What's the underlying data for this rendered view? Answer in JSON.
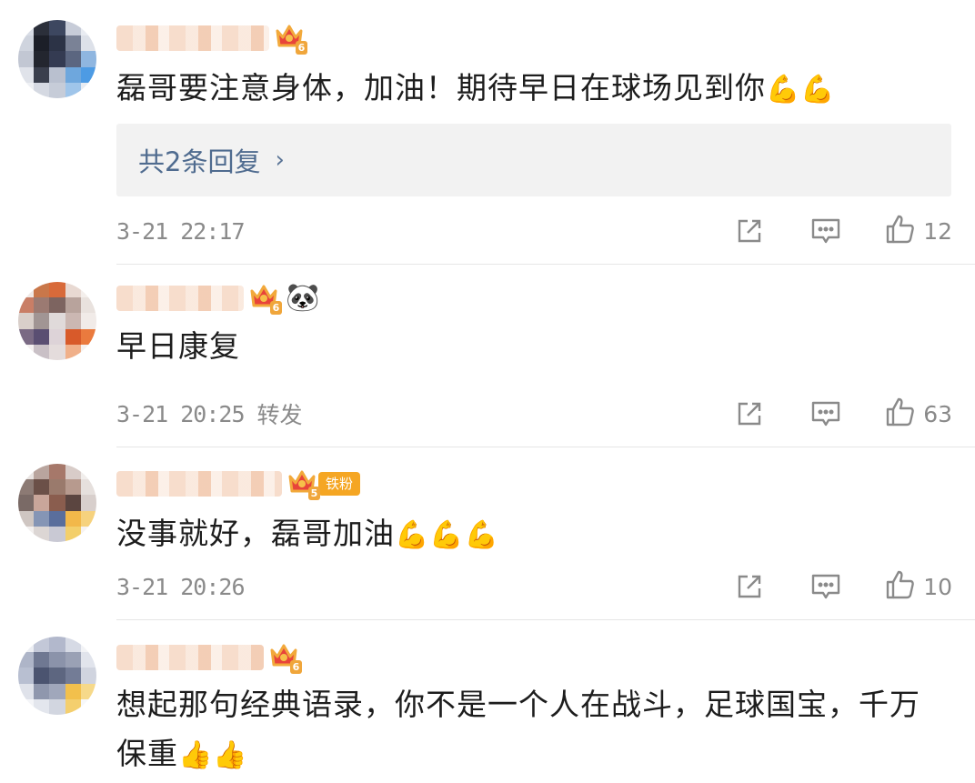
{
  "colors": {
    "link": "#4f6b8f",
    "meta": "#8a8a8a",
    "badge": "#f5a623",
    "reply_bg": "#f2f2f2"
  },
  "comments": [
    {
      "crown_level": "6",
      "text": "磊哥要注意身体，加油！期待早日在球场见到你",
      "emoji": "💪💪",
      "replies_label": "共2条回复",
      "time": "3-21 22:17",
      "likes": "12"
    },
    {
      "crown_level": "6",
      "badge_icon": "panda-icon",
      "text": "早日康复",
      "time": "3-21 20:25",
      "tag": "转发",
      "likes": "63"
    },
    {
      "crown_level": "5",
      "fan_badge": "铁粉",
      "text": "没事就好，磊哥加油",
      "emoji": "💪💪💪",
      "time": "3-21 20:26",
      "likes": "10"
    },
    {
      "crown_level": "6",
      "text": "想起那句经典语录，你不是一个人在战斗，足球国宝，千万保重",
      "emoji": "👍👍"
    }
  ],
  "icons": {
    "share": "share-icon",
    "comment": "comment-icon",
    "like": "thumbs-up-icon",
    "crown": "crown-icon",
    "chevron": "chevron-right-icon"
  }
}
